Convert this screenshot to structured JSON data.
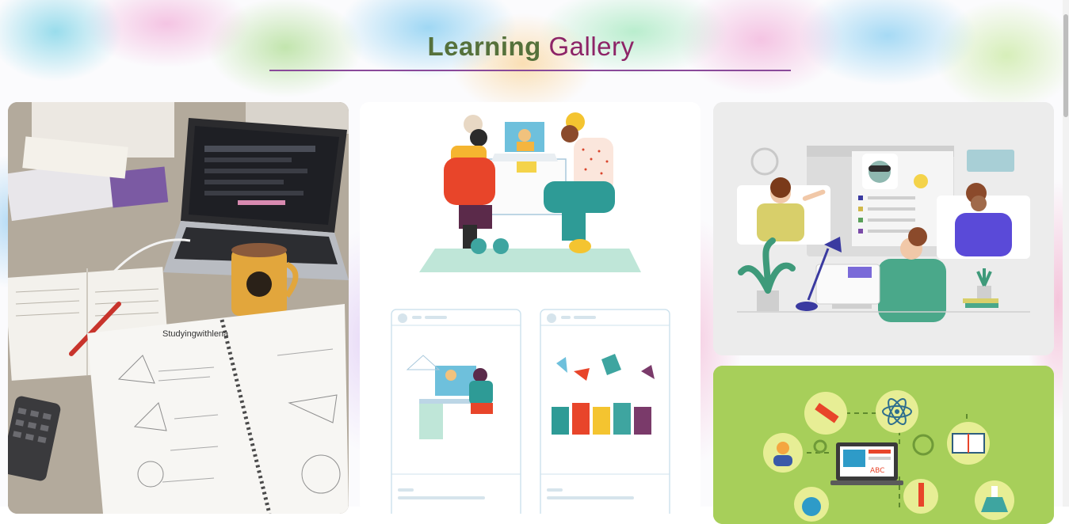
{
  "page": {
    "title_word1": "Learning",
    "title_word2": "Gallery"
  },
  "photo": {
    "notebook_label": "Studyingwithlena"
  },
  "mockup": {
    "badge_text": "ABC"
  },
  "colors": {
    "title_green": "#55713b",
    "title_purple": "#8d2467",
    "rule": "#8a4a9a",
    "green_tile": "#a7cf5a"
  }
}
